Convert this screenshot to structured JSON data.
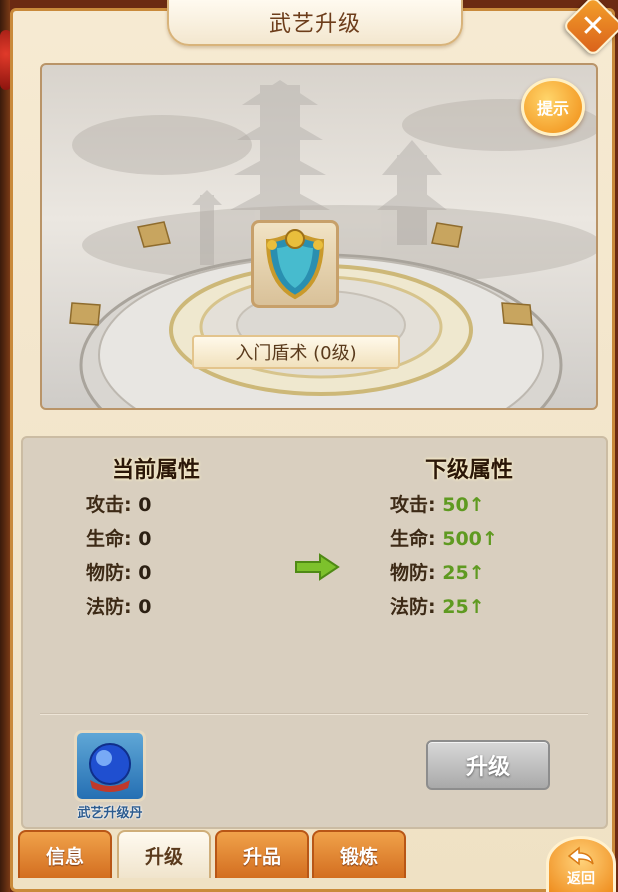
{
  "window": {
    "title": "武艺升级",
    "close_symbol": "✕"
  },
  "scene": {
    "hint_button_label": "提示",
    "skill_name": "入门盾术 (0级)"
  },
  "stats": {
    "current_title": "当前属性",
    "next_title": "下级属性",
    "current": [
      {
        "label": "攻击:",
        "value": "0"
      },
      {
        "label": "生命:",
        "value": "0"
      },
      {
        "label": "物防:",
        "value": "0"
      },
      {
        "label": "法防:",
        "value": "0"
      }
    ],
    "next": [
      {
        "label": "攻击:",
        "value": "50↑"
      },
      {
        "label": "生命:",
        "value": "500↑"
      },
      {
        "label": "物防:",
        "value": "25↑"
      },
      {
        "label": "法防:",
        "value": "25↑"
      }
    ]
  },
  "item": {
    "label": "武艺升级丹"
  },
  "upgrade_button_label": "升级",
  "tabs": [
    {
      "label": "信息",
      "active": false
    },
    {
      "label": "升级",
      "active": true
    },
    {
      "label": "升品",
      "active": false
    },
    {
      "label": "锻炼",
      "active": false
    }
  ],
  "back_button_label": "返回",
  "colors": {
    "frame_border": "#c98a3b",
    "tab_orange": "#d36e20",
    "stat_up_green": "#5f9a21",
    "panel_bg": "#d9cfbf"
  },
  "icons": [
    "close-icon",
    "hint-icon",
    "shield-skill-icon",
    "right-arrow-icon",
    "blue-orb-item-icon",
    "back-arrow-icon"
  ]
}
